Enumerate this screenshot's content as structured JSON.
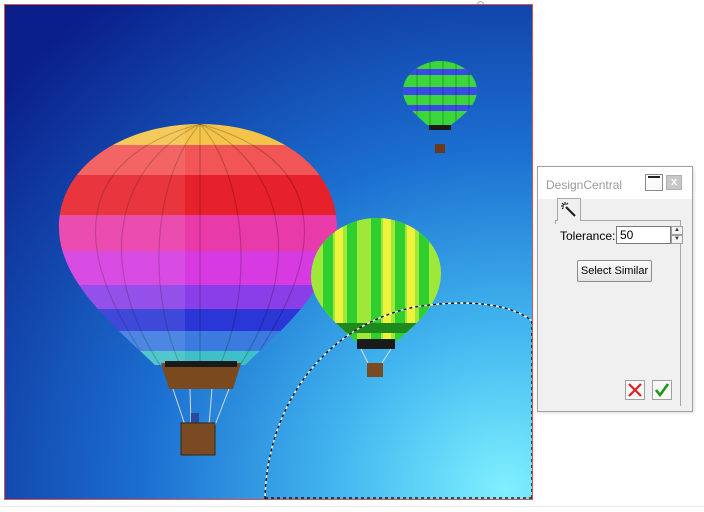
{
  "canvas": {
    "image_subject": "hot-air-balloons",
    "colors": {
      "sky_top": "#0a1f8a",
      "sky_mid": "#1d63c8",
      "sky_glow": "#6fe3ff",
      "frame_border": "#d9534f"
    }
  },
  "panel": {
    "title": "DesignCentral",
    "close_label": "x",
    "tab_icon": "magic-wand-icon",
    "tolerance": {
      "label": "Tolerance:",
      "value": "50"
    },
    "select_similar_label": "Select Similar",
    "cancel_icon": "x-mark-icon",
    "ok_icon": "checkmark-icon",
    "colors": {
      "cancel": "#e02020",
      "ok": "#1a9a1a"
    }
  }
}
